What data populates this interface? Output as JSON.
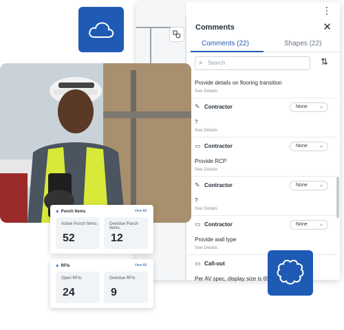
{
  "app": {
    "menu_icon": "kebab-icon",
    "tool_icon": "shapes-tool-icon"
  },
  "comments_panel": {
    "title": "Comments",
    "tabs": [
      {
        "label": "Comments (22)",
        "active": true
      },
      {
        "label": "Shapes (22)",
        "active": false
      }
    ],
    "search_placeholder": "Search",
    "items": [
      {
        "author": "",
        "text": "Provide details on flooring transition",
        "details": "See Details",
        "status": "",
        "icon": ""
      },
      {
        "author": "Contractor",
        "text": "?",
        "details": "See Details",
        "status": "None",
        "icon": "pencil-icon"
      },
      {
        "author": "Contractor",
        "text": "Provide RCP",
        "details": "See Details",
        "status": "None",
        "icon": "comment-icon"
      },
      {
        "author": "Contractor",
        "text": "?",
        "details": "See Details",
        "status": "None",
        "icon": "pencil-icon"
      },
      {
        "author": "Contractor",
        "text": "Provide wall type",
        "details": "See Details",
        "status": "None",
        "icon": "comment-icon"
      },
      {
        "author": "Call-out",
        "text": "Per AV spec, display size is 65",
        "details": "",
        "status": "",
        "icon": "comment-icon"
      }
    ]
  },
  "punch_card": {
    "title": "Punch Items",
    "view_all": "View All",
    "stats": [
      {
        "label": "Active Punch Items:",
        "value": "52"
      },
      {
        "label": "Overdue Punch Items:",
        "value": "12"
      }
    ]
  },
  "rfi_card": {
    "title": "RFIs",
    "view_all": "View All",
    "stats": [
      {
        "label": "Open RFIs:",
        "value": "24"
      },
      {
        "label": "Overdue RFIs:",
        "value": "9"
      }
    ]
  },
  "colors": {
    "brand_blue": "#1f5bb5"
  }
}
